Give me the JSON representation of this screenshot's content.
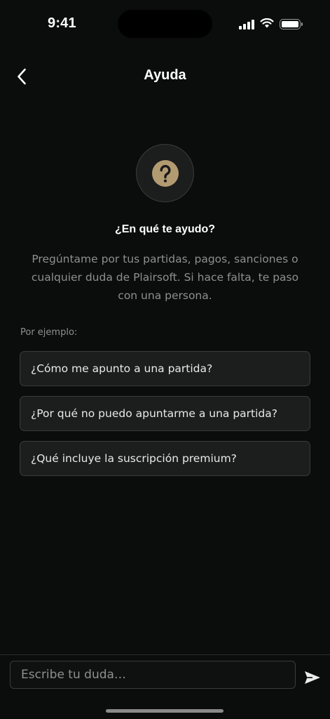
{
  "status_bar": {
    "time": "9:41",
    "icons": [
      "signal-icon",
      "wifi-icon",
      "battery-icon"
    ]
  },
  "nav": {
    "title": "Ayuda",
    "back_icon": "chevron-left-icon"
  },
  "hero": {
    "icon": "question-mark-icon",
    "headline": "¿En qué te ayudo?",
    "description": "Pregúntame por tus partidas, pagos, sanciones o cualquier duda de Plairsoft. Si hace falta, te paso con una persona."
  },
  "examples": {
    "label": "Por ejemplo:",
    "items": [
      "¿Cómo me apunto a una partida?",
      "¿Por qué no puedo apuntarme a una partida?",
      "¿Qué incluye la suscripción premium?"
    ]
  },
  "composer": {
    "placeholder": "Escribe tu duda…",
    "value": "",
    "send_icon": "send-icon"
  },
  "colors": {
    "background": "#0b0c0c",
    "surface": "#1c1d1d",
    "border": "#3a3b3b",
    "accent": "#b39b71",
    "muted_text": "#8e8f8f"
  }
}
